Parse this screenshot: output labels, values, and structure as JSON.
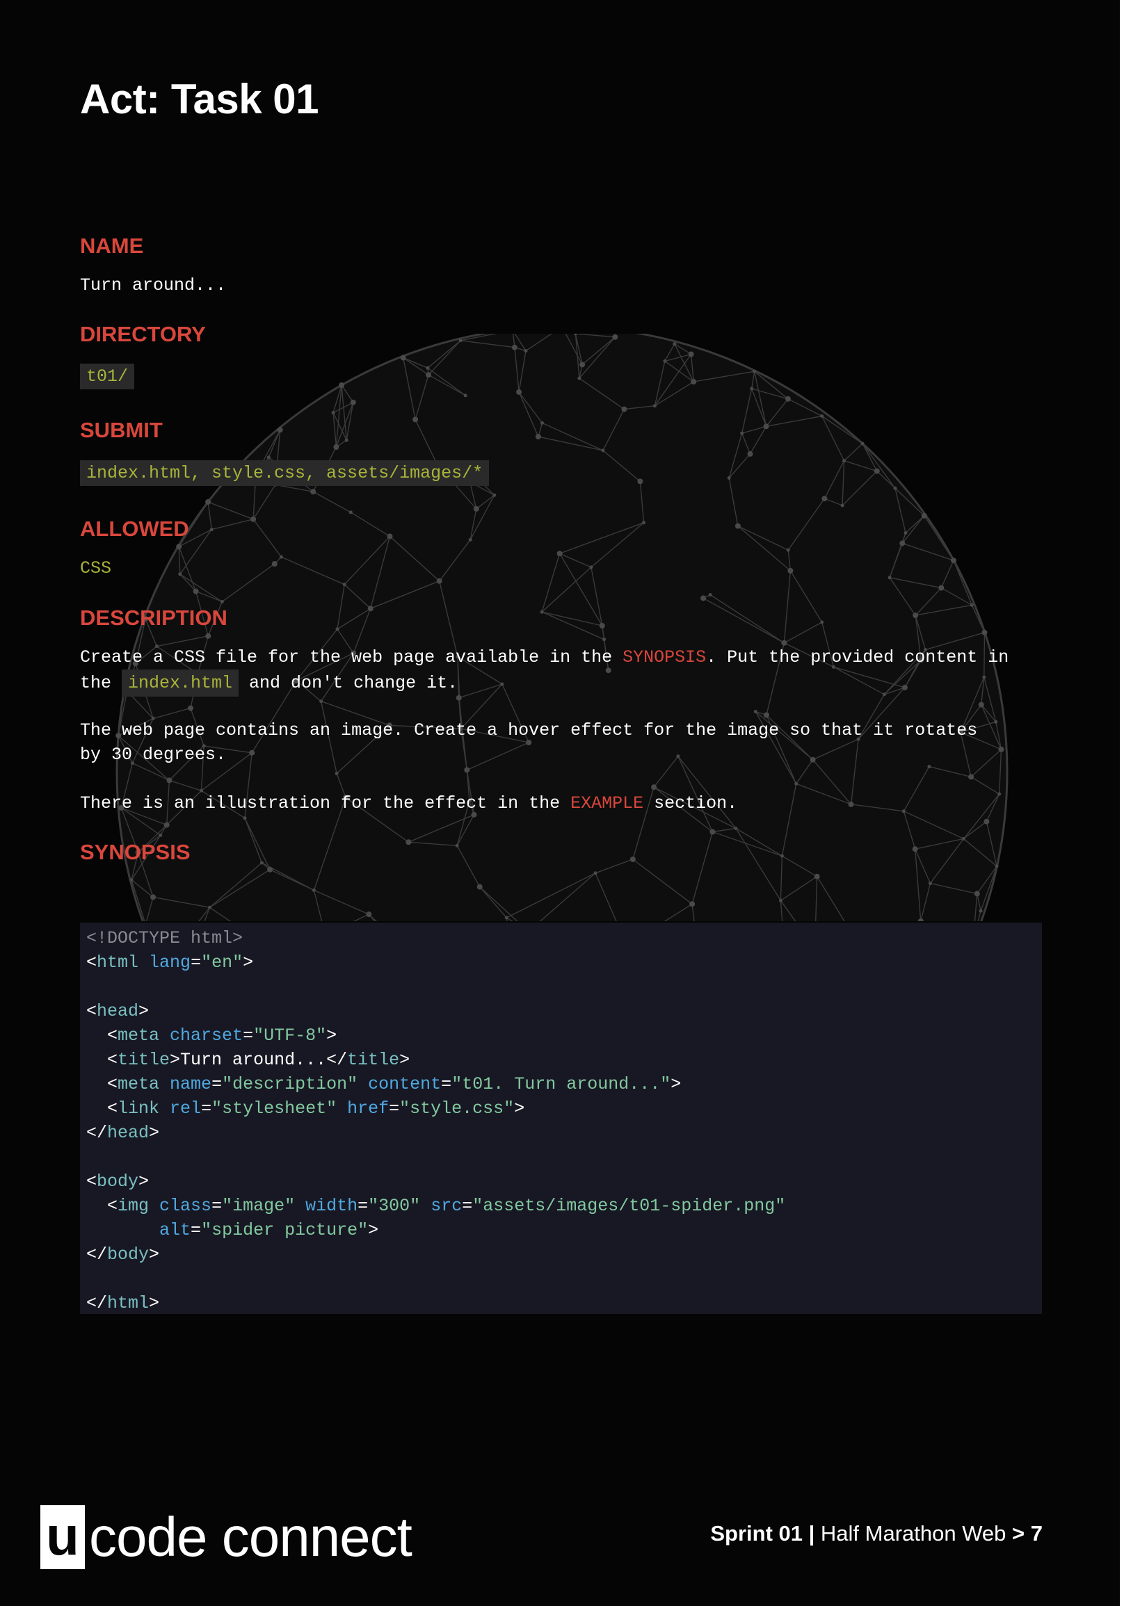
{
  "page": {
    "title": "Act: Task 01",
    "sections": {
      "name": {
        "heading": "NAME",
        "value": "Turn around..."
      },
      "directory": {
        "heading": "DIRECTORY",
        "value": "t01/"
      },
      "submit": {
        "heading": "SUBMIT",
        "value": "index.html, style.css, assets/images/*"
      },
      "allowed": {
        "heading": "ALLOWED",
        "value": "CSS"
      },
      "description": {
        "heading": "DESCRIPTION",
        "p1_a": "Create a CSS file for the web page available in the ",
        "p1_link": "SYNOPSIS",
        "p1_b": ". Put the provided content in",
        "p1_c": "the ",
        "p1_code": "index.html",
        "p1_d": " and don't change it.",
        "p2_l1": "The web page contains an image. Create a hover effect for the image so that it rotates",
        "p2_l2": "by 30 degrees.",
        "p3_a": "There is an illustration for the effect in the ",
        "p3_link": "EXAMPLE",
        "p3_b": " section."
      },
      "synopsis": {
        "heading": "SYNOPSIS"
      }
    }
  },
  "code": {
    "l1": "<!DOCTYPE html>",
    "l2_open": "<",
    "l2_tag": "html",
    "l2_attr": "lang",
    "l2_eq": "=",
    "l2_val": "\"en\"",
    "l2_close": ">",
    "head_open_a": "<",
    "head_open_tag": "head",
    "head_open_b": ">",
    "meta1_a": "  <",
    "meta1_tag": "meta",
    "meta1_attr": "charset",
    "meta1_eq": "=",
    "meta1_val": "\"UTF-8\"",
    "meta1_b": ">",
    "title_a": "  <",
    "title_tag": "title",
    "title_b": ">",
    "title_text": "Turn around...",
    "title_c": "</",
    "title_tag2": "title",
    "title_d": ">",
    "meta2_a": "  <",
    "meta2_tag": "meta",
    "meta2_attr1": "name",
    "meta2_eq1": "=",
    "meta2_val1": "\"description\"",
    "meta2_attr2": "content",
    "meta2_eq2": "=",
    "meta2_val2": "\"t01. Turn around...\"",
    "meta2_b": ">",
    "link_a": "  <",
    "link_tag": "link",
    "link_attr1": "rel",
    "link_eq1": "=",
    "link_val1": "\"stylesheet\"",
    "link_attr2": "href",
    "link_eq2": "=",
    "link_val2": "\"style.css\"",
    "link_b": ">",
    "head_close_a": "</",
    "head_close_tag": "head",
    "head_close_b": ">",
    "body_open_a": "<",
    "body_open_tag": "body",
    "body_open_b": ">",
    "img_a": "  <",
    "img_tag": "img",
    "img_attr1": "class",
    "img_eq1": "=",
    "img_val1": "\"image\"",
    "img_attr2": "width",
    "img_eq2": "=",
    "img_val2": "\"300\"",
    "img_attr3": "src",
    "img_eq3": "=",
    "img_val3": "\"assets/images/t01-spider.png\"",
    "img2_attr": "alt",
    "img2_eq": "=",
    "img2_val": "\"spider picture\"",
    "img2_b": ">",
    "body_close_a": "</",
    "body_close_tag": "body",
    "body_close_b": ">",
    "html_close_a": "</",
    "html_close_tag": "html",
    "html_close_b": ">"
  },
  "footer": {
    "logo_box": "u",
    "logo_text": "code connect",
    "sprint": "Sprint 01 |",
    "course": " Half Marathon Web ",
    "page": "> 7"
  },
  "colors": {
    "background": "#050505",
    "accent_red": "#d9473c",
    "accent_green": "#a9b43a",
    "code_background": "#181824"
  },
  "icons": {
    "background_graphic": "wireframe-sphere",
    "logo": "ucode-logo"
  }
}
